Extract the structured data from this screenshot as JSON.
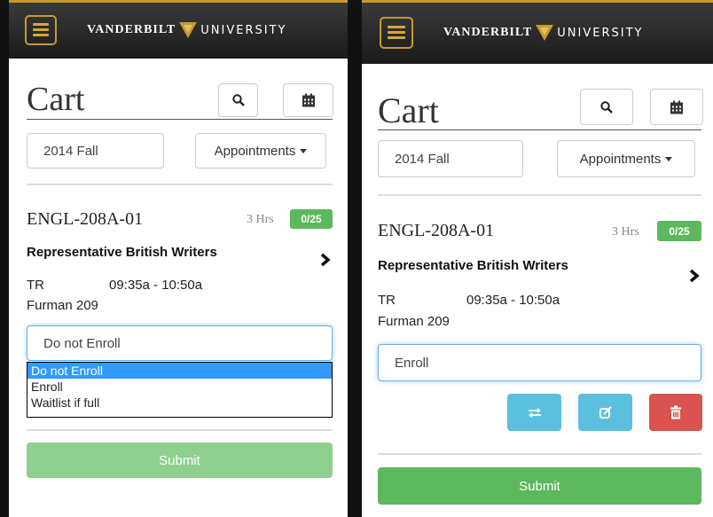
{
  "header": {
    "brand_left": "VANDERBILT",
    "brand_right": "UNIVERSITY",
    "logo_color": "#c69b2b",
    "bg_color": "#2a2a2a"
  },
  "left": {
    "page_title": "Cart",
    "term": "2014 Fall",
    "appointments_label": "Appointments",
    "course": {
      "code": "ENGL-208A-01",
      "hours": "3 Hrs",
      "seats": "0/25",
      "title": "Representative British Writers",
      "days": "TR",
      "time": "09:35a - 10:50a",
      "location": "Furman 209"
    },
    "enroll_select": {
      "value": "Do not Enroll",
      "options": [
        "Do not Enroll",
        "Enroll",
        "Waitlist if full"
      ],
      "selected_index": 0
    },
    "submit_label": "Submit",
    "submit_color": "#8fd08f"
  },
  "right": {
    "page_title": "Cart",
    "term": "2014 Fall",
    "appointments_label": "Appointments",
    "course": {
      "code": "ENGL-208A-01",
      "hours": "3 Hrs",
      "seats": "0/25",
      "title": "Representative British Writers",
      "days": "TR",
      "time": "09:35a - 10:50a",
      "location": "Furman 209"
    },
    "enroll_select": {
      "value": "Enroll"
    },
    "actions": [
      {
        "name": "swap",
        "icon": "swap-icon",
        "color": "#5bc0de"
      },
      {
        "name": "edit",
        "icon": "edit-icon",
        "color": "#5bc0de"
      },
      {
        "name": "delete",
        "icon": "trash-icon",
        "color": "#d9534f"
      }
    ],
    "submit_label": "Submit",
    "submit_color": "#5cb85c"
  }
}
